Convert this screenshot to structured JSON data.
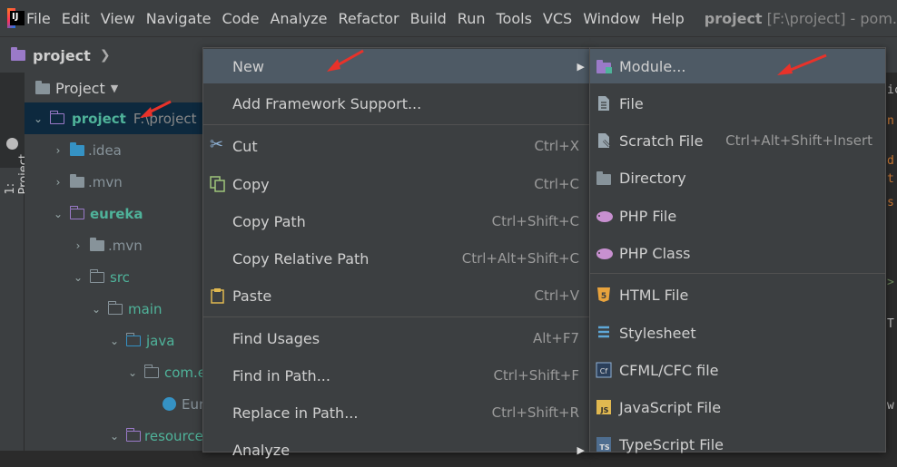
{
  "menubar": {
    "logo": "IJ",
    "items": [
      "File",
      "Edit",
      "View",
      "Navigate",
      "Code",
      "Analyze",
      "Refactor",
      "Build",
      "Run",
      "Tools",
      "VCS",
      "Window",
      "Help"
    ],
    "title_project": "project",
    "title_rest": "[F:\\project] - pom."
  },
  "breadcrumb": {
    "label": "project"
  },
  "side": {
    "tab_label": "1: Project"
  },
  "project_panel": {
    "header": "Project",
    "tree": [
      {
        "label": "project",
        "extra": "F:\\project",
        "type": "module"
      },
      {
        "label": ".idea",
        "type": "idea"
      },
      {
        "label": ".mvn",
        "type": "folder"
      },
      {
        "label": "eureka",
        "type": "module"
      },
      {
        "label": ".mvn",
        "type": "folder"
      },
      {
        "label": "src",
        "type": "src"
      },
      {
        "label": "main",
        "type": "folder"
      },
      {
        "label": "java",
        "type": "java"
      },
      {
        "label": "com.e",
        "type": "package"
      },
      {
        "label": "Eur",
        "type": "class"
      },
      {
        "label": "resource",
        "type": "resource"
      }
    ]
  },
  "context_menu": {
    "items": [
      {
        "label": "New",
        "shortcut": "",
        "icon": ""
      },
      {
        "label": "Add Framework Support...",
        "shortcut": "",
        "icon": ""
      },
      {
        "label": "Cut",
        "shortcut": "Ctrl+X",
        "icon": "scissors-icon"
      },
      {
        "label": "Copy",
        "shortcut": "Ctrl+C",
        "icon": "copy-icon"
      },
      {
        "label": "Copy Path",
        "shortcut": "Ctrl+Shift+C",
        "icon": ""
      },
      {
        "label": "Copy Relative Path",
        "shortcut": "Ctrl+Alt+Shift+C",
        "icon": ""
      },
      {
        "label": "Paste",
        "shortcut": "Ctrl+V",
        "icon": "clipboard-icon"
      },
      {
        "label": "Find Usages",
        "shortcut": "Alt+F7",
        "icon": ""
      },
      {
        "label": "Find in Path...",
        "shortcut": "Ctrl+Shift+F",
        "icon": ""
      },
      {
        "label": "Replace in Path...",
        "shortcut": "Ctrl+Shift+R",
        "icon": ""
      },
      {
        "label": "Analyze",
        "shortcut": "",
        "icon": ""
      }
    ]
  },
  "submenu": {
    "items": [
      {
        "label": "Module...",
        "shortcut": "",
        "icon": "module-icon"
      },
      {
        "label": "File",
        "shortcut": "",
        "icon": "file-icon"
      },
      {
        "label": "Scratch File",
        "shortcut": "Ctrl+Alt+Shift+Insert",
        "icon": "scratch-file-icon"
      },
      {
        "label": "Directory",
        "shortcut": "",
        "icon": "folder-icon"
      },
      {
        "label": "PHP File",
        "shortcut": "",
        "icon": "php-icon"
      },
      {
        "label": "PHP Class",
        "shortcut": "",
        "icon": "php-icon"
      },
      {
        "label": "HTML File",
        "shortcut": "",
        "icon": "html5-icon"
      },
      {
        "label": "Stylesheet",
        "shortcut": "",
        "icon": "css3-icon"
      },
      {
        "label": "CFML/CFC file",
        "shortcut": "",
        "icon": "cfml-icon"
      },
      {
        "label": "JavaScript File",
        "shortcut": "",
        "icon": "js-icon"
      },
      {
        "label": "TypeScript File",
        "shortcut": "",
        "icon": "ts-icon"
      }
    ]
  },
  "colors": {
    "annotation_arrow": "#e8322a",
    "menu_highlight": "#4e5a65",
    "module_teal": "#4fb39a"
  }
}
